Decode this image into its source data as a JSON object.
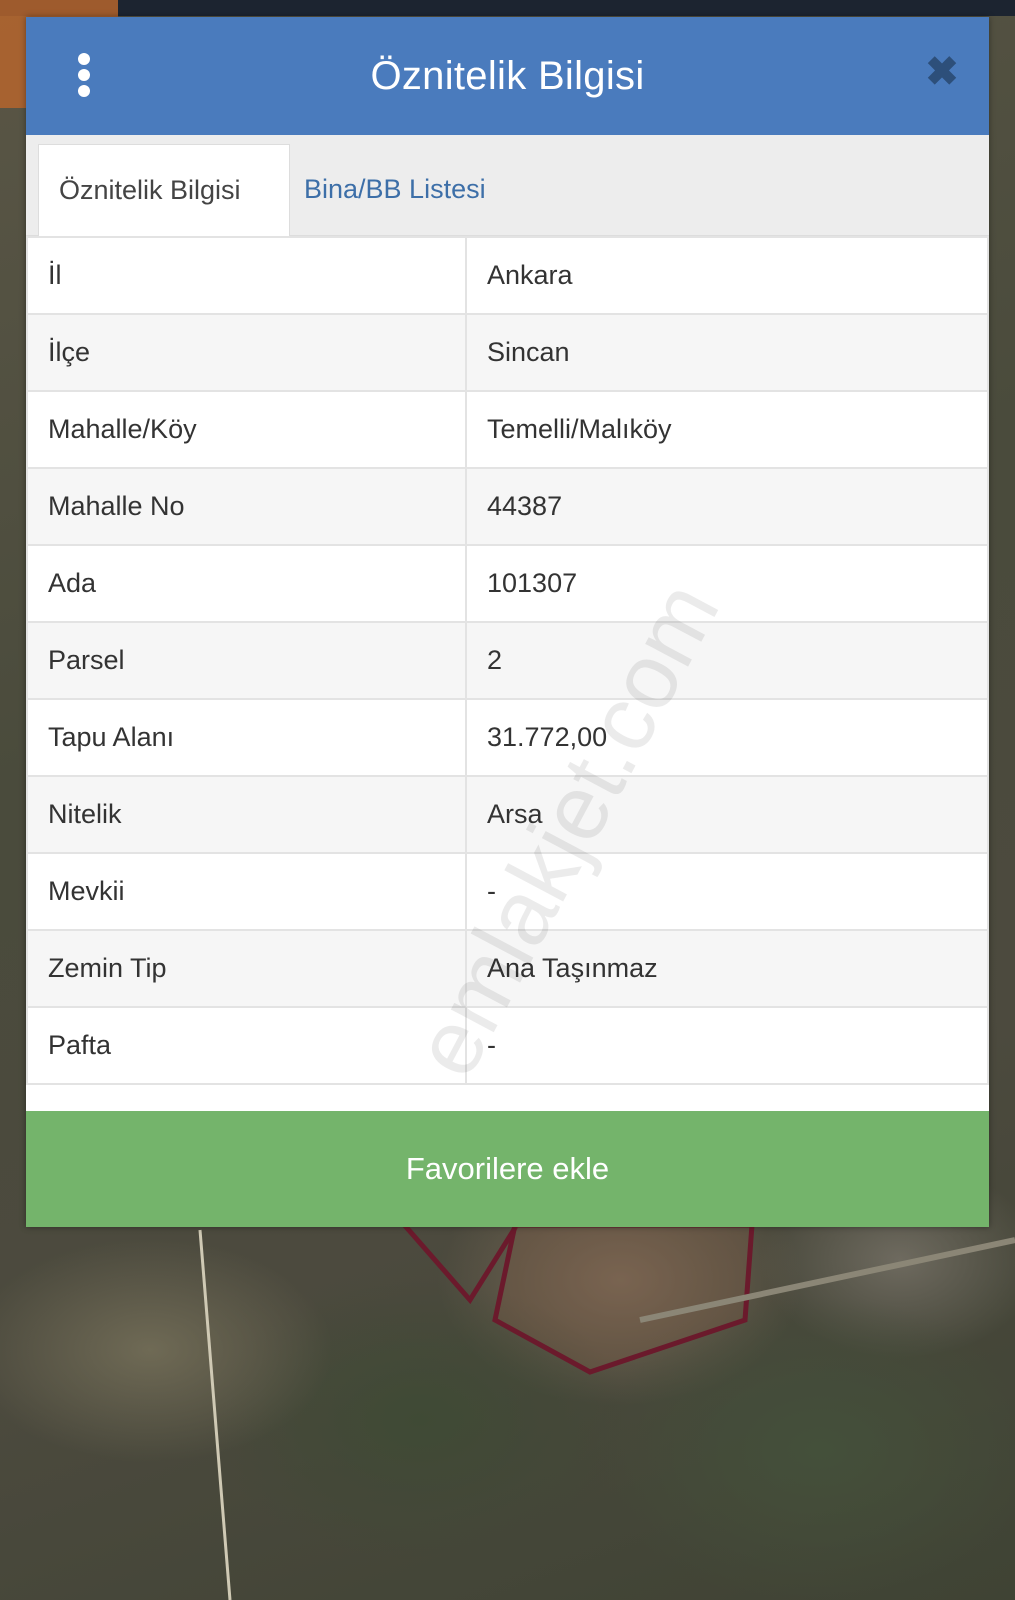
{
  "dialog": {
    "title": "Öznitelik Bilgisi",
    "tabs": [
      {
        "label": "Öznitelik Bilgisi",
        "active": true
      },
      {
        "label": "Bina/BB Listesi",
        "active": false
      }
    ],
    "rows": [
      {
        "key": "İl",
        "value": "Ankara"
      },
      {
        "key": "İlçe",
        "value": "Sincan"
      },
      {
        "key": "Mahalle/Köy",
        "value": "Temelli/Malıköy"
      },
      {
        "key": "Mahalle No",
        "value": "44387"
      },
      {
        "key": "Ada",
        "value": "101307"
      },
      {
        "key": "Parsel",
        "value": "2"
      },
      {
        "key": "Tapu Alanı",
        "value": "31.772,00"
      },
      {
        "key": "Nitelik",
        "value": "Arsa"
      },
      {
        "key": "Mevkii",
        "value": "-"
      },
      {
        "key": "Zemin Tip",
        "value": "Ana Taşınmaz"
      },
      {
        "key": "Pafta",
        "value": "-"
      }
    ],
    "favorite_button": "Favorilere ekle",
    "watermark": "emlakjet.com",
    "icons": {
      "menu": "vertical-dots-icon",
      "close": "close-icon"
    }
  },
  "colors": {
    "header": "#4a7bbd",
    "tab_link": "#3d6fa8",
    "button": "#74b46b",
    "parcel_outline": "#6b1a2c"
  }
}
